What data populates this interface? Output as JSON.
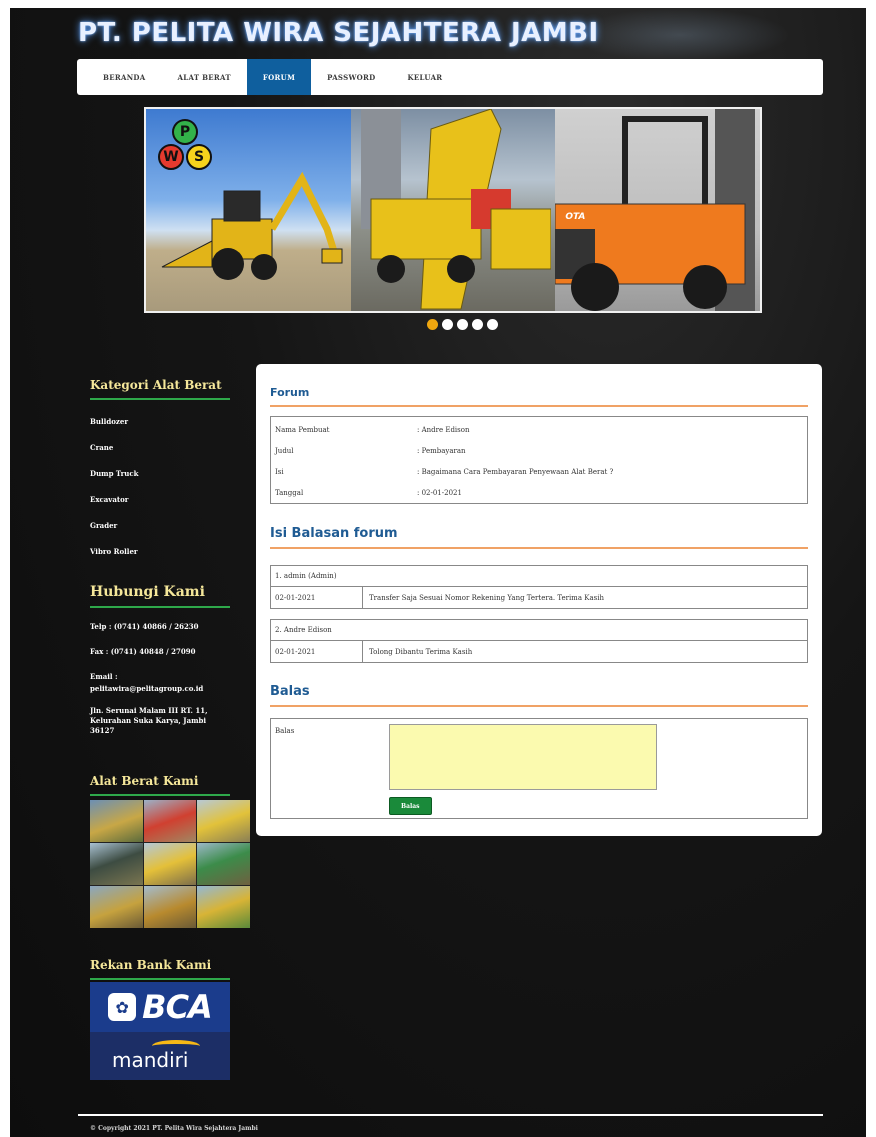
{
  "header": {
    "title": "PT. PELITA WIRA SEJAHTERA JAMBI"
  },
  "nav": {
    "items": [
      "BERANDA",
      "ALAT BERAT",
      "FORUM",
      "PASSWORD",
      "KELUAR"
    ],
    "active": "FORUM"
  },
  "banner": {
    "logo_letters": [
      "P",
      "W",
      "S"
    ],
    "forklift_label": "OTA",
    "slide_count": 5,
    "active_slide": 1,
    "active_dot_color": "#f0a70f"
  },
  "sidebar": {
    "categories_title": "Kategori Alat Berat",
    "categories": [
      "Bulldozer",
      "Crane",
      "Dump Truck",
      "Excavator",
      "Grader",
      "Vibro Roller"
    ],
    "contact_title": "Hubungi Kami",
    "phone": "Telp : (0741) 40866 / 26230",
    "fax": "Fax : (0741) 40848 / 27090",
    "email_label": "Email :",
    "email": "pelitawira@pelitagroup.co.id",
    "address": "Jln. Serunai Malam III RT. 11, Kelurahan Suka Karya, Jambi 36127",
    "gallery_title": "Alat Berat Kami",
    "bank_title": "Rekan Bank Kami",
    "banks": [
      "BCA",
      "mandiri"
    ]
  },
  "forum": {
    "title": "Forum",
    "info": [
      {
        "label": "Nama Pembuat",
        "value": ": Andre Edison"
      },
      {
        "label": "Judul",
        "value": ": Pembayaran"
      },
      {
        "label": "Isi",
        "value": ": Bagaimana Cara Pembayaran Penyewaan Alat Berat ?"
      },
      {
        "label": "Tanggal",
        "value": ": 02-01-2021"
      }
    ]
  },
  "replies": {
    "title": "Isi Balasan forum",
    "items": [
      {
        "header": "1. admin (Admin)",
        "date": "02-01-2021",
        "text": "Transfer Saja Sesuai Nomor Rekening Yang Tertera. Terima Kasih"
      },
      {
        "header": "2. Andre Edison",
        "date": "02-01-2021",
        "text": "Tolong Dibantu Terima Kasih"
      }
    ]
  },
  "reply_form": {
    "title": "Balas",
    "label": "Balas",
    "value": "",
    "submit": "Balas"
  },
  "footer": {
    "text": "© Copyright 2021 PT. Pelita Wira Sejahtera Jambi"
  },
  "colors": {
    "accent_blue": "#0f5f9e",
    "heading_blue": "#1f5b93",
    "divider_orange": "#f0a265",
    "sidebar_heading": "#f5e79a",
    "sidebar_rule": "#2ea84a",
    "textarea_bg": "#fbfaaf",
    "submit_green": "#1a8a3a"
  }
}
